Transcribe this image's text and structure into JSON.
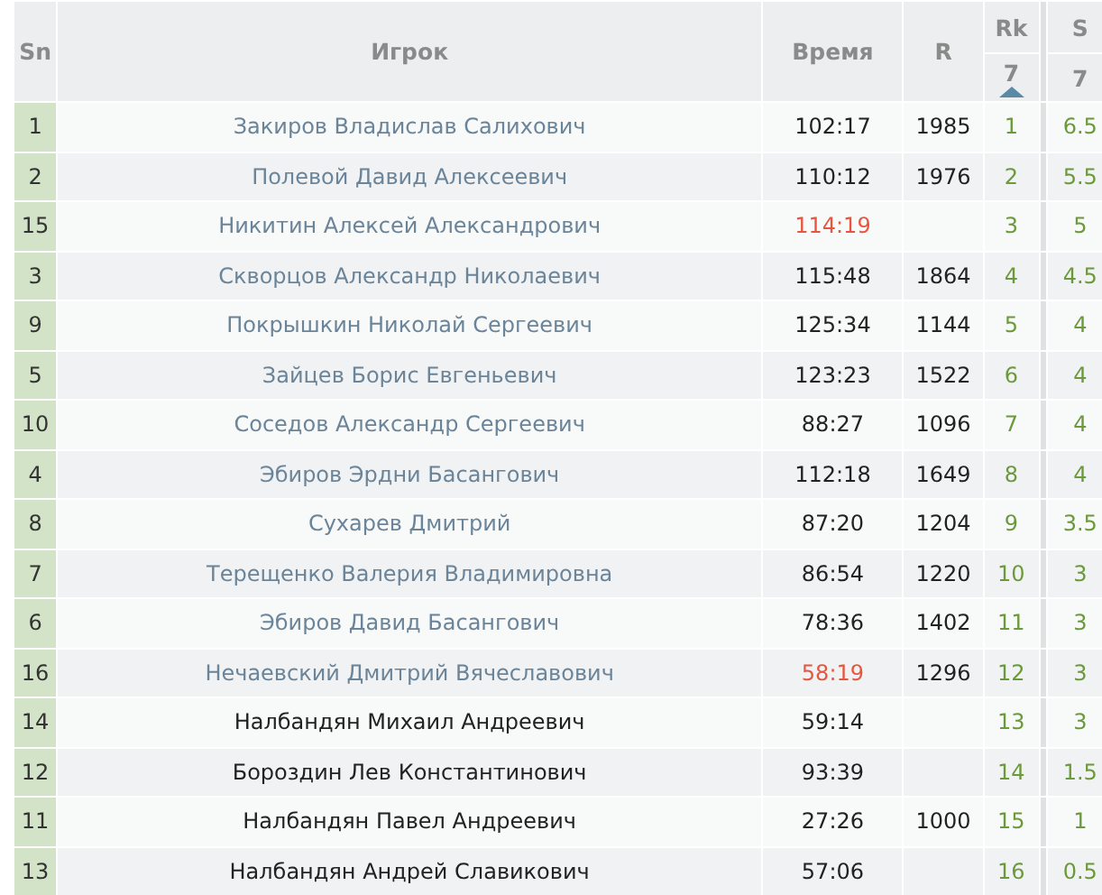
{
  "table": {
    "columns": [
      {
        "label": "Sn"
      },
      {
        "label": "Игрок"
      },
      {
        "label": "Время"
      },
      {
        "label": "R"
      },
      {
        "label": "Rk",
        "sub": "7",
        "sorted": true
      },
      {
        "label": "S",
        "sub": "7",
        "sorted": false
      }
    ],
    "rows": [
      {
        "sn": "1",
        "player": "Закиров Владислав Салихович",
        "linked": true,
        "time": "102:17",
        "time_flagged": false,
        "rating": "1985",
        "rank": "1",
        "score": "6.5"
      },
      {
        "sn": "2",
        "player": "Полевой Давид Алексеевич",
        "linked": true,
        "time": "110:12",
        "time_flagged": false,
        "rating": "1976",
        "rank": "2",
        "score": "5.5"
      },
      {
        "sn": "15",
        "player": "Никитин Алексей Александрович",
        "linked": true,
        "time": "114:19",
        "time_flagged": true,
        "rating": "",
        "rank": "3",
        "score": "5"
      },
      {
        "sn": "3",
        "player": "Скворцов Александр Николаевич",
        "linked": true,
        "time": "115:48",
        "time_flagged": false,
        "rating": "1864",
        "rank": "4",
        "score": "4.5"
      },
      {
        "sn": "9",
        "player": "Покрышкин Николай Сергеевич",
        "linked": true,
        "time": "125:34",
        "time_flagged": false,
        "rating": "1144",
        "rank": "5",
        "score": "4"
      },
      {
        "sn": "5",
        "player": "Зайцев Борис Евгеньевич",
        "linked": true,
        "time": "123:23",
        "time_flagged": false,
        "rating": "1522",
        "rank": "6",
        "score": "4"
      },
      {
        "sn": "10",
        "player": "Соседов Александр Сергеевич",
        "linked": true,
        "time": "88:27",
        "time_flagged": false,
        "rating": "1096",
        "rank": "7",
        "score": "4"
      },
      {
        "sn": "4",
        "player": "Эбиров Эрдни Басангович",
        "linked": true,
        "time": "112:18",
        "time_flagged": false,
        "rating": "1649",
        "rank": "8",
        "score": "4"
      },
      {
        "sn": "8",
        "player": "Сухарев Дмитрий",
        "linked": true,
        "time": "87:20",
        "time_flagged": false,
        "rating": "1204",
        "rank": "9",
        "score": "3.5"
      },
      {
        "sn": "7",
        "player": "Терещенко Валерия Владимировна",
        "linked": true,
        "time": "86:54",
        "time_flagged": false,
        "rating": "1220",
        "rank": "10",
        "score": "3"
      },
      {
        "sn": "6",
        "player": "Эбиров Давид Басангович",
        "linked": true,
        "time": "78:36",
        "time_flagged": false,
        "rating": "1402",
        "rank": "11",
        "score": "3"
      },
      {
        "sn": "16",
        "player": "Нечаевский Дмитрий Вячеславович",
        "linked": true,
        "time": "58:19",
        "time_flagged": true,
        "rating": "1296",
        "rank": "12",
        "score": "3"
      },
      {
        "sn": "14",
        "player": "Налбандян Михаил Андреевич",
        "linked": false,
        "time": "59:14",
        "time_flagged": false,
        "rating": "",
        "rank": "13",
        "score": "3"
      },
      {
        "sn": "12",
        "player": "Бороздин Лев Константинович",
        "linked": false,
        "time": "93:39",
        "time_flagged": false,
        "rating": "",
        "rank": "14",
        "score": "1.5"
      },
      {
        "sn": "11",
        "player": "Налбандян Павел Андреевич",
        "linked": false,
        "time": "27:26",
        "time_flagged": false,
        "rating": "1000",
        "rank": "15",
        "score": "1"
      },
      {
        "sn": "13",
        "player": "Налбандян Андрей Славикович",
        "linked": false,
        "time": "57:06",
        "time_flagged": false,
        "rating": "",
        "rank": "16",
        "score": "0.5"
      }
    ]
  }
}
